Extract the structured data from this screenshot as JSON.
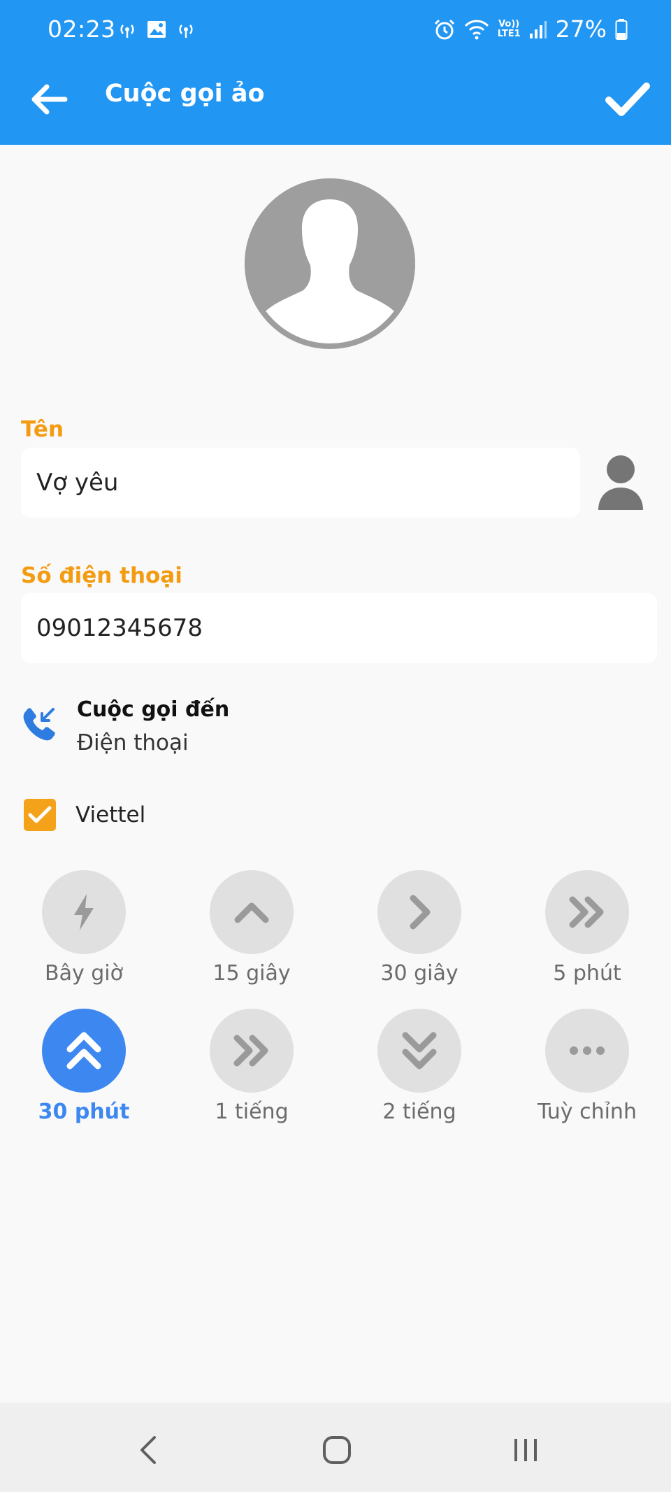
{
  "status_bar": {
    "time": "02:23",
    "battery": "27%",
    "network_line1": "Vo))",
    "network_line2": "LTE1"
  },
  "app_bar": {
    "title": "Cuộc gọi ảo",
    "back_icon": "arrow-left-icon",
    "confirm_icon": "check-icon"
  },
  "form": {
    "name_label": "Tên",
    "name_value": "Vợ yêu",
    "phone_label": "Số điện thoại",
    "phone_value": "09012345678"
  },
  "call_type": {
    "title": "Cuộc gọi đến",
    "subtitle": "Điện thoại",
    "icon": "incoming-call-icon"
  },
  "carrier": {
    "label": "Viettel",
    "checked": true
  },
  "timers": [
    {
      "label": "Bây giờ",
      "icon": "bolt-icon",
      "selected": false
    },
    {
      "label": "15 giây",
      "icon": "chevron-up-icon",
      "selected": false
    },
    {
      "label": "30 giây",
      "icon": "chevron-right-icon",
      "selected": false
    },
    {
      "label": "5 phút",
      "icon": "double-chevron-right-icon",
      "selected": false
    },
    {
      "label": "30 phút",
      "icon": "double-chevron-up-icon",
      "selected": true
    },
    {
      "label": "1 tiếng",
      "icon": "double-chevron-right-icon",
      "selected": false
    },
    {
      "label": "2 tiếng",
      "icon": "double-chevron-down-icon",
      "selected": false
    },
    {
      "label": "Tuỳ chỉnh",
      "icon": "more-dots-icon",
      "selected": false
    }
  ],
  "colors": {
    "primary": "#2196f3",
    "accent_label": "#f39c12",
    "checkbox": "#f5a21b",
    "selected_timer": "#3d87f0",
    "timer_idle": "#e0e0e0"
  }
}
